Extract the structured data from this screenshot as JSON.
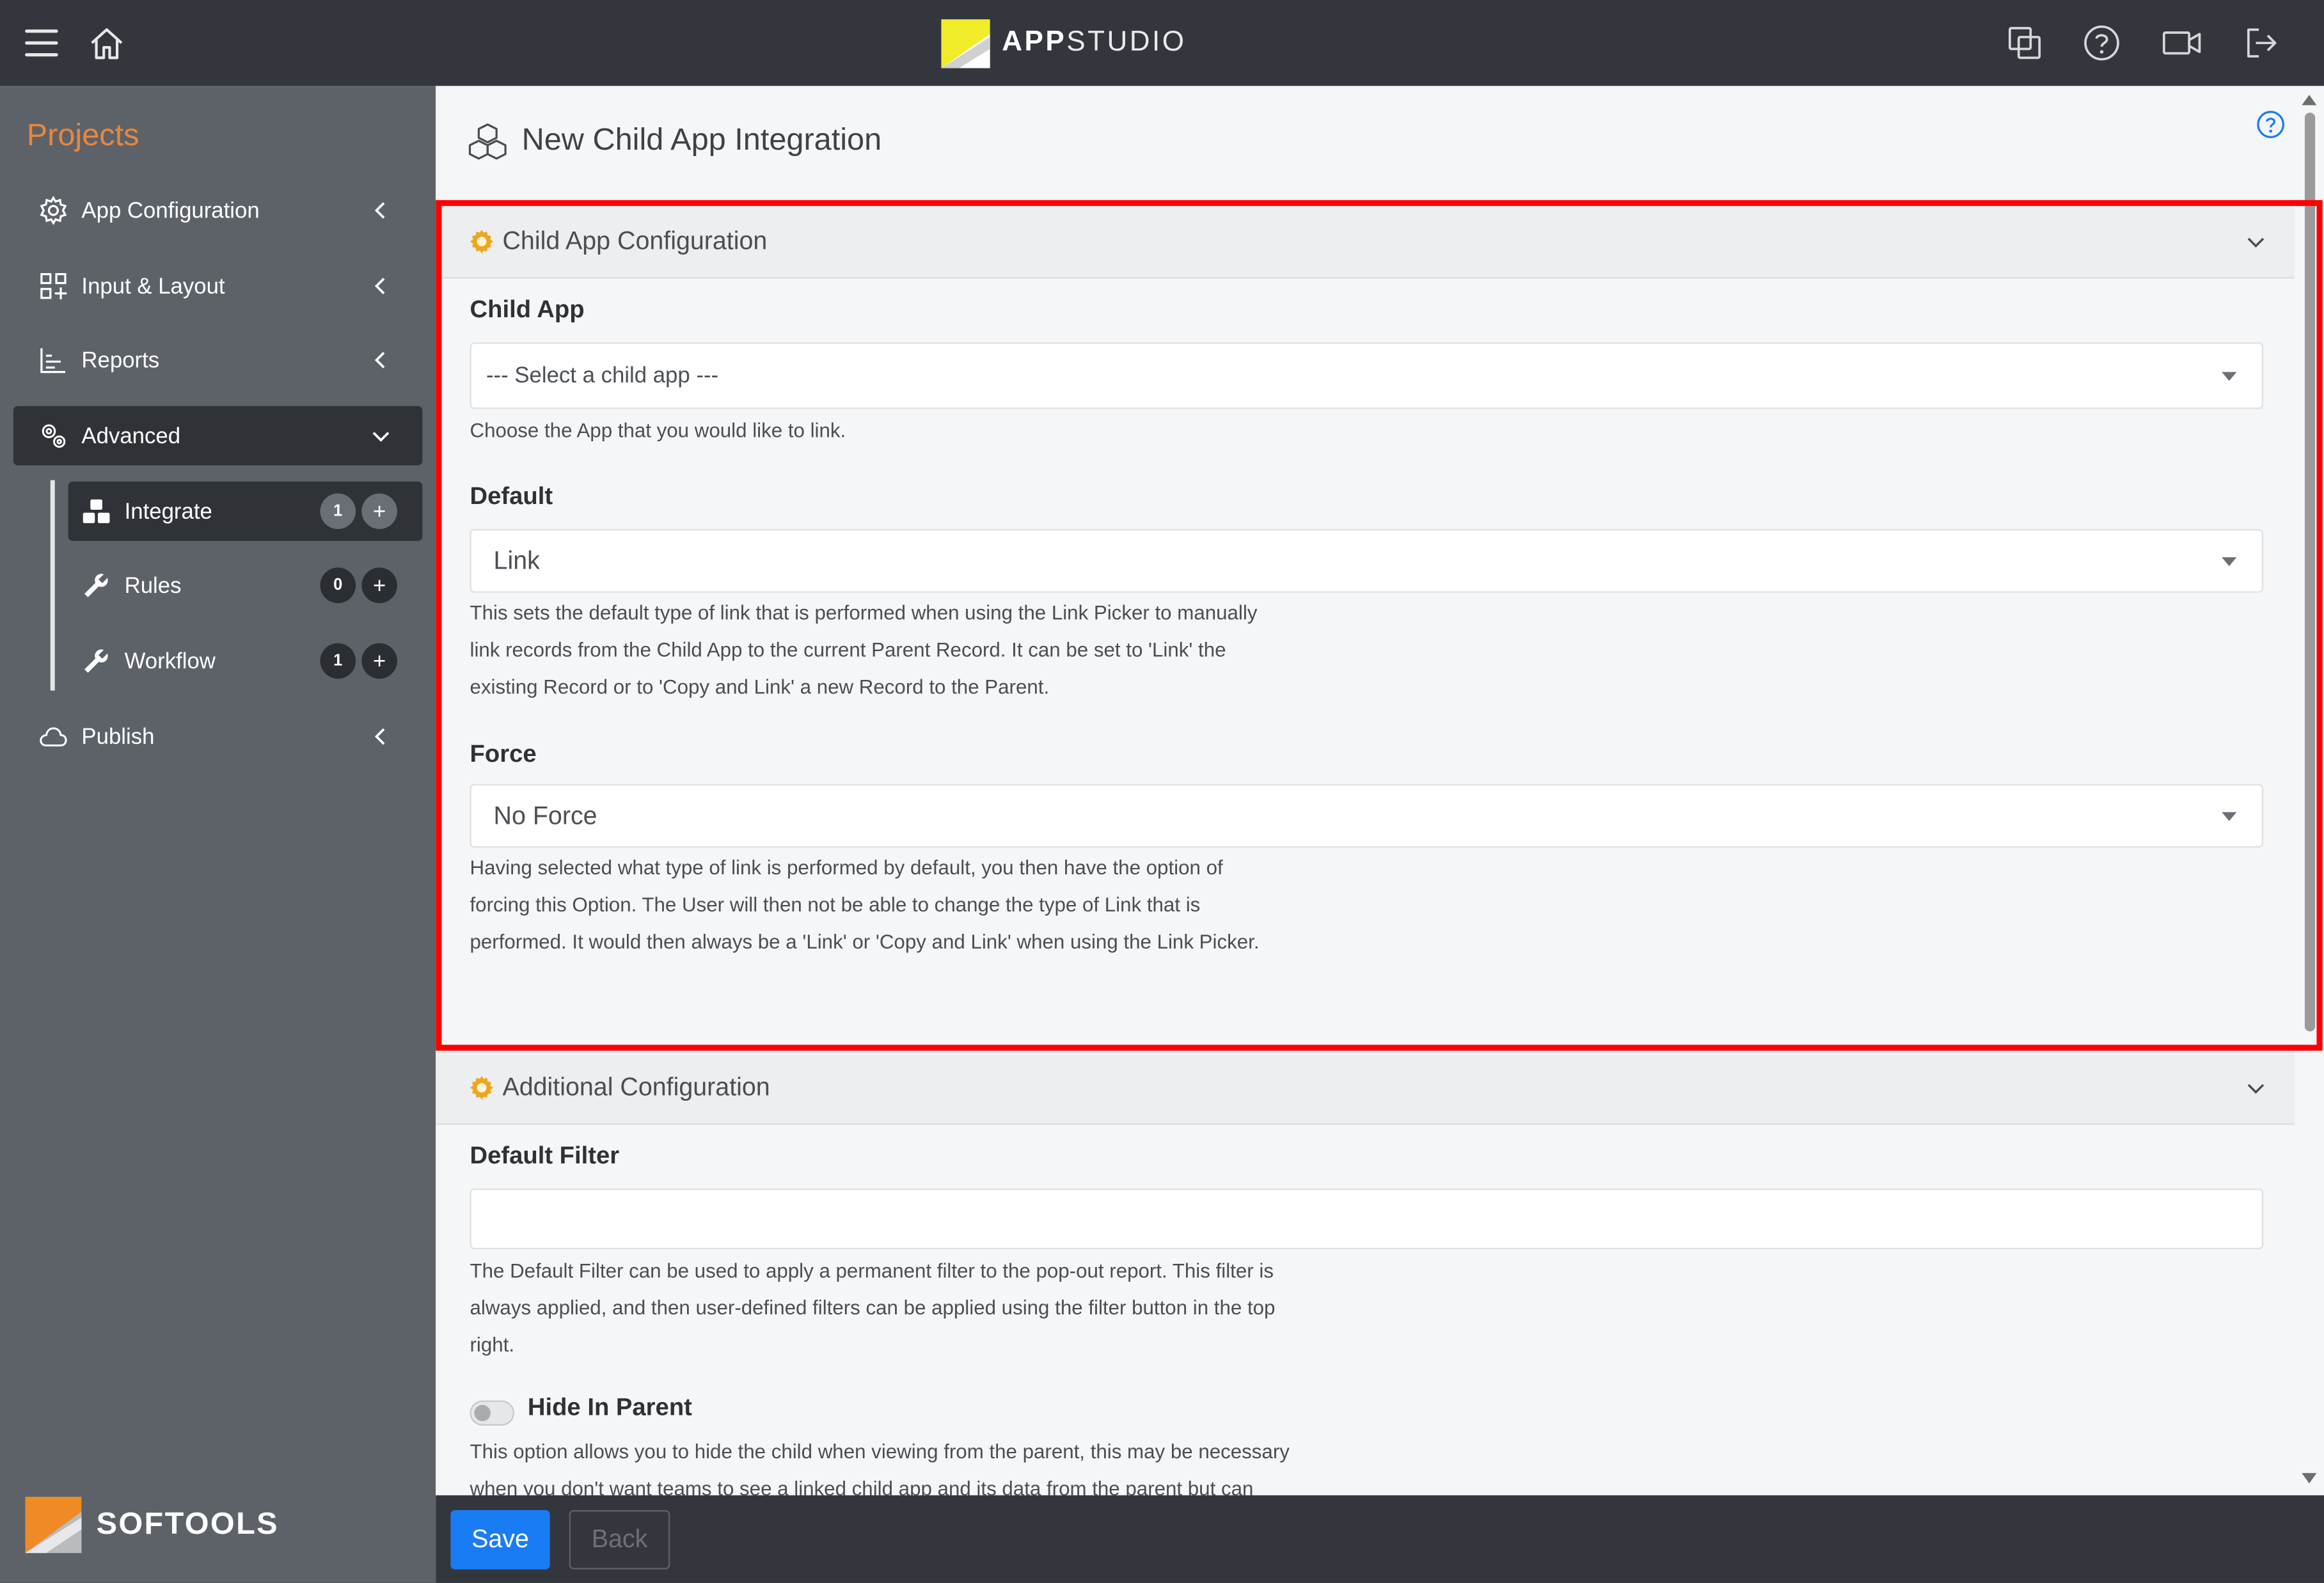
{
  "brand": {
    "prefix": "APP",
    "suffix": "STUDIO"
  },
  "topbar": {
    "left_icons": [
      "hamburger-menu-icon",
      "home-icon"
    ],
    "right_icons": [
      "copy-windows-icon",
      "help-icon",
      "video-icon",
      "logout-icon"
    ]
  },
  "sidebar": {
    "projects_title": "Projects",
    "items": [
      {
        "label": "App Configuration",
        "icon": "gear-icon"
      },
      {
        "label": "Input & Layout",
        "icon": "layout-grid-icon"
      },
      {
        "label": "Reports",
        "icon": "chart-icon"
      },
      {
        "label": "Advanced",
        "icon": "gears-icon"
      }
    ],
    "sub_items": [
      {
        "label": "Integrate",
        "count": "1",
        "plus": "+",
        "icon": "cubes-icon"
      },
      {
        "label": "Rules",
        "count": "0",
        "plus": "+",
        "icon": "wrench-icon"
      },
      {
        "label": "Workflow",
        "count": "1",
        "plus": "+",
        "icon": "wrench-icon"
      }
    ],
    "publish_label": "Publish",
    "logo_text": "SOFTOOLS"
  },
  "page": {
    "title": "New Child App Integration"
  },
  "child_config": {
    "title": "Child App Configuration",
    "child_app": {
      "label": "Child App",
      "value": "--- Select a child app ---",
      "help_lines": [
        "Choose the App that you would like to link."
      ]
    },
    "default": {
      "label": "Default",
      "value": "Link",
      "help_lines": [
        "This sets the default type of link that is performed when using the Link Picker to manually",
        "link records from the Child App to the current Parent Record. It can be set to 'Link' the",
        "existing Record or to 'Copy and Link' a new Record to the Parent."
      ]
    },
    "force": {
      "label": "Force",
      "value": "No Force",
      "help_lines": [
        "Having selected what type of link is performed by default, you then have the option of",
        "forcing this Option. The User will then not be able to change the type of Link that is",
        "performed. It would then always be a 'Link' or 'Copy and Link' when using the Link Picker."
      ]
    }
  },
  "additional_config": {
    "title": "Additional Configuration",
    "default_filter": {
      "label": "Default Filter",
      "value": "",
      "help_lines": [
        "The Default Filter can be used to apply a permanent filter to the pop-out report. This filter is",
        "always applied, and then user-defined filters can be applied using the filter button in the top",
        "right."
      ]
    },
    "hide_in_parent": {
      "label": "Hide In Parent",
      "enabled": false,
      "help_lines": [
        "This option allows you to hide the child when viewing from the parent, this may be necessary",
        "when you don't want teams to see a linked child app and its data from the parent but can"
      ]
    }
  },
  "footer": {
    "save_label": "Save",
    "back_label": "Back"
  },
  "colors": {
    "accent": "#1a7cf5",
    "highlight": "#ff0000",
    "projects": "#e9873a",
    "topbar": "#33373d",
    "sidebar": "#5d6269"
  }
}
